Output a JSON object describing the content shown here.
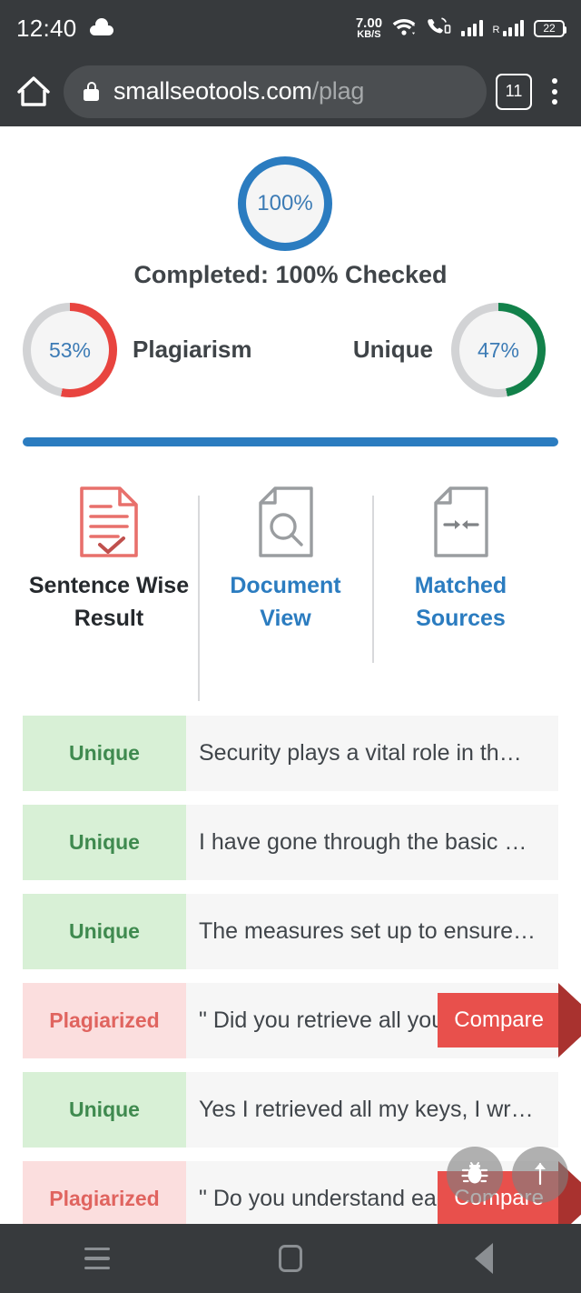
{
  "status_bar": {
    "time": "12:40",
    "cloud_icon": "cloud-icon",
    "net_speed_value": "7.00",
    "net_speed_unit": "KB/S",
    "wifi_icon": "wifi-icon",
    "call_icon": "call-signal-icon",
    "signal_icon": "signal-bars-icon",
    "roaming_label": "R",
    "roaming_icon": "roaming-signal-icon",
    "battery_level": "22"
  },
  "browser": {
    "home_icon": "home-icon",
    "lock_icon": "lock-icon",
    "url_main": "smallseotools.com",
    "url_path": "/plag",
    "tab_count": "11",
    "menu_icon": "kebab-menu-icon"
  },
  "result": {
    "overall_percent": "100%",
    "completed_text": "Completed: 100% Checked",
    "plagiarism_percent": "53%",
    "plagiarism_label": "Plagiarism",
    "unique_label": "Unique",
    "unique_percent": "47%"
  },
  "tabs": [
    {
      "label": "Sentence Wise Result",
      "icon": "document-checklist-icon",
      "active": true
    },
    {
      "label": "Document View",
      "icon": "document-search-icon",
      "active": false
    },
    {
      "label": "Matched Sources",
      "icon": "document-compare-icon",
      "active": false
    }
  ],
  "sentences": [
    {
      "status": "Unique",
      "text": "Security plays a vital role in th…",
      "compare": null
    },
    {
      "status": "Unique",
      "text": "I have gone through the basic …",
      "compare": null
    },
    {
      "status": "Unique",
      "text": "The measures set up to ensure…",
      "compare": null
    },
    {
      "status": "Plagiarized",
      "text": "\" Did you retrieve all your …",
      "compare": "Compare"
    },
    {
      "status": "Unique",
      "text": "Yes I retrieved all my keys, I wr…",
      "compare": null
    },
    {
      "status": "Plagiarized",
      "text": "\" Do you understand each …",
      "compare": "Compare"
    }
  ],
  "floating_buttons": [
    {
      "name": "bug-report-button",
      "icon": "bug-icon"
    },
    {
      "name": "scroll-to-top-button",
      "icon": "arrow-up-icon"
    }
  ],
  "nav_bar": {
    "recents_icon": "hamburger-recents-icon",
    "home_icon": "home-square-icon",
    "back_icon": "back-triangle-icon"
  },
  "colors": {
    "accent_blue": "#2b7cc0",
    "plagiarism_red": "#e8443f",
    "unique_green": "#12814a",
    "compare_red": "#e8504c",
    "chrome_dark": "#373a3d"
  }
}
